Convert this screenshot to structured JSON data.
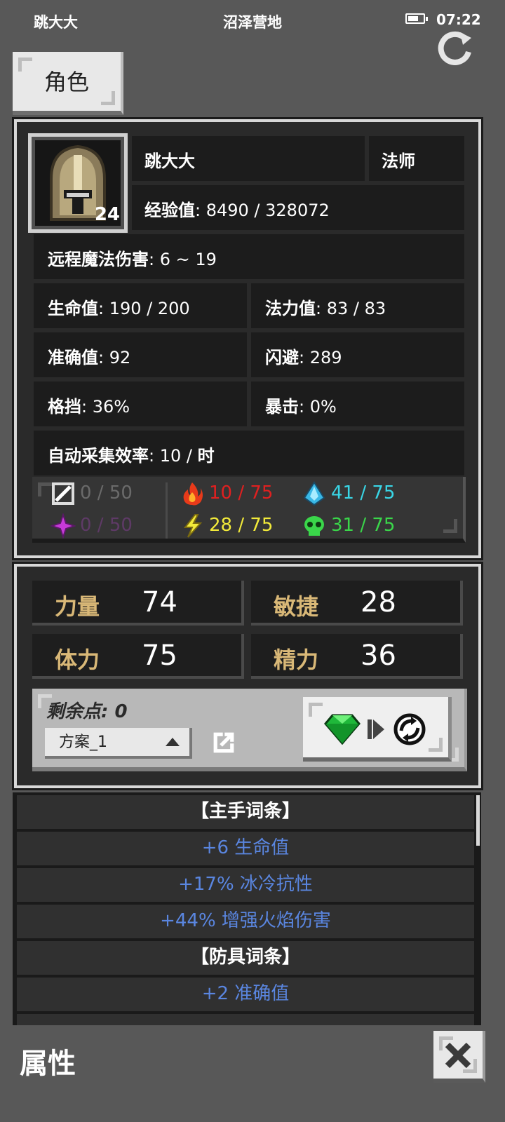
{
  "status": {
    "left": "跳大大",
    "center": "沼泽营地",
    "time": "07:22"
  },
  "tab": {
    "label": "角色"
  },
  "character": {
    "name": "跳大大",
    "class": "法师",
    "level": "24",
    "exp_label": "经验值",
    "exp_value": ": 8490 / 328072",
    "damage_label": "远程魔法伤害",
    "damage_value": ": 6 ~ 19",
    "hp_label": "生命值",
    "hp_value": ": 190 / 200",
    "mp_label": "法力值",
    "mp_value": ": 83 / 83",
    "acc_label": "准确值",
    "acc_value": ": 92",
    "dodge_label": "闪避",
    "dodge_value": ": 289",
    "block_label": "格挡",
    "block_value": ": 36%",
    "crit_label": "暴击",
    "crit_value": ": 0%",
    "gather_label": "自动采集效率",
    "gather_value": ": 10 / ",
    "gather_unit": "时"
  },
  "resistances": {
    "physical": "0 / 50",
    "arcane": "0 / 50",
    "fire": "10 / 75",
    "lightning": "28 / 75",
    "cold": "41 / 75",
    "poison": "31 / 75",
    "colors": {
      "physical": "#6a6a6a",
      "arcane": "#5e3a66",
      "fire": "#e02020",
      "lightning": "#f2ea3a",
      "cold": "#39d6e6",
      "poison": "#3ad64a"
    }
  },
  "attributes": {
    "str_label": "力量",
    "str_value": "74",
    "dex_label": "敏捷",
    "dex_value": "28",
    "vit_label": "体力",
    "vit_value": "75",
    "ene_label": "精力",
    "ene_value": "36",
    "remaining": "剩余点: 0",
    "plan": "方案_1"
  },
  "affixes": [
    {
      "text": "【主手词条】"
    },
    {
      "text": "+6 生命值"
    },
    {
      "text": "+17% 冰冷抗性"
    },
    {
      "text": "+44% 增强火焰伤害"
    },
    {
      "text": "【防具词条】"
    },
    {
      "text": "+2 准确值"
    },
    {
      "text": ""
    }
  ],
  "footer": {
    "title": "属性"
  }
}
